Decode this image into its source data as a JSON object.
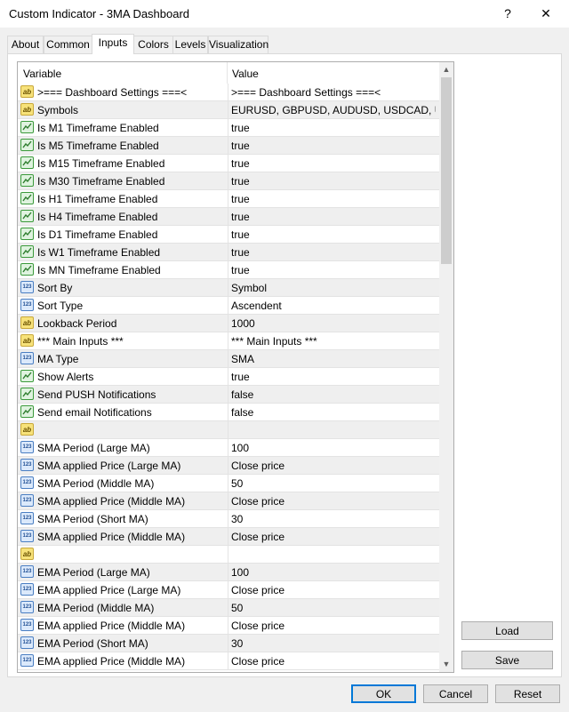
{
  "window": {
    "title": "Custom Indicator - 3MA Dashboard",
    "help_glyph": "?",
    "close_glyph": "✕"
  },
  "tabs": [
    {
      "label": "About",
      "active": false
    },
    {
      "label": "Common",
      "active": false
    },
    {
      "label": "Inputs",
      "active": true
    },
    {
      "label": "Colors",
      "active": false
    },
    {
      "label": "Levels",
      "active": false
    },
    {
      "label": "Visualization",
      "active": false
    }
  ],
  "grid": {
    "col_variable": "Variable",
    "col_value": "Value",
    "rows": [
      {
        "icon": "ab",
        "variable": ">=== Dashboard Settings ===<",
        "value": ">=== Dashboard Settings ===<"
      },
      {
        "icon": "ab",
        "variable": "Symbols",
        "value": "EURUSD, GBPUSD, AUDUSD, USDCAD, U..."
      },
      {
        "icon": "bool",
        "variable": "Is M1 Timeframe Enabled",
        "value": "true"
      },
      {
        "icon": "bool",
        "variable": "Is M5 Timeframe Enabled",
        "value": "true"
      },
      {
        "icon": "bool",
        "variable": "Is M15 Timeframe Enabled",
        "value": "true"
      },
      {
        "icon": "bool",
        "variable": "Is M30 Timeframe Enabled",
        "value": "true"
      },
      {
        "icon": "bool",
        "variable": "Is H1 Timeframe Enabled",
        "value": "true"
      },
      {
        "icon": "bool",
        "variable": "Is H4 Timeframe Enabled",
        "value": "true"
      },
      {
        "icon": "bool",
        "variable": "Is D1 Timeframe Enabled",
        "value": "true"
      },
      {
        "icon": "bool",
        "variable": "Is W1 Timeframe Enabled",
        "value": "true"
      },
      {
        "icon": "bool",
        "variable": "Is MN Timeframe Enabled",
        "value": "true"
      },
      {
        "icon": "num",
        "variable": "Sort By",
        "value": "Symbol"
      },
      {
        "icon": "num",
        "variable": "Sort Type",
        "value": "Ascendent"
      },
      {
        "icon": "ab",
        "variable": "Lookback Period",
        "value": "1000"
      },
      {
        "icon": "ab",
        "variable": "*** Main Inputs ***",
        "value": "*** Main Inputs ***"
      },
      {
        "icon": "num",
        "variable": "MA Type",
        "value": "SMA"
      },
      {
        "icon": "bool",
        "variable": "Show Alerts",
        "value": "true"
      },
      {
        "icon": "bool",
        "variable": "Send PUSH Notifications",
        "value": "false"
      },
      {
        "icon": "bool",
        "variable": "Send email Notifications",
        "value": "false"
      },
      {
        "icon": "ab",
        "variable": "",
        "value": ""
      },
      {
        "icon": "num",
        "variable": "SMA Period (Large MA)",
        "value": "100"
      },
      {
        "icon": "num",
        "variable": "SMA applied Price (Large MA)",
        "value": "Close price"
      },
      {
        "icon": "num",
        "variable": "SMA Period (Middle MA)",
        "value": "50"
      },
      {
        "icon": "num",
        "variable": "SMA applied Price (Middle MA)",
        "value": "Close price"
      },
      {
        "icon": "num",
        "variable": "SMA Period (Short MA)",
        "value": "30"
      },
      {
        "icon": "num",
        "variable": "SMA applied Price (Middle MA)",
        "value": "Close price"
      },
      {
        "icon": "ab",
        "variable": "",
        "value": ""
      },
      {
        "icon": "num",
        "variable": "EMA Period (Large MA)",
        "value": "100"
      },
      {
        "icon": "num",
        "variable": "EMA applied Price (Large MA)",
        "value": "Close price"
      },
      {
        "icon": "num",
        "variable": "EMA Period (Middle MA)",
        "value": "50"
      },
      {
        "icon": "num",
        "variable": "EMA applied Price (Middle MA)",
        "value": "Close price"
      },
      {
        "icon": "num",
        "variable": "EMA Period (Short MA)",
        "value": "30"
      },
      {
        "icon": "num",
        "variable": "EMA applied Price (Middle MA)",
        "value": "Close price"
      }
    ]
  },
  "icons": {
    "ab": "ab",
    "num": "123"
  },
  "scroll": {
    "up": "▲",
    "down": "▼"
  },
  "side_buttons": {
    "load": "Load",
    "save": "Save"
  },
  "footer_buttons": {
    "ok": "OK",
    "cancel": "Cancel",
    "reset": "Reset"
  }
}
